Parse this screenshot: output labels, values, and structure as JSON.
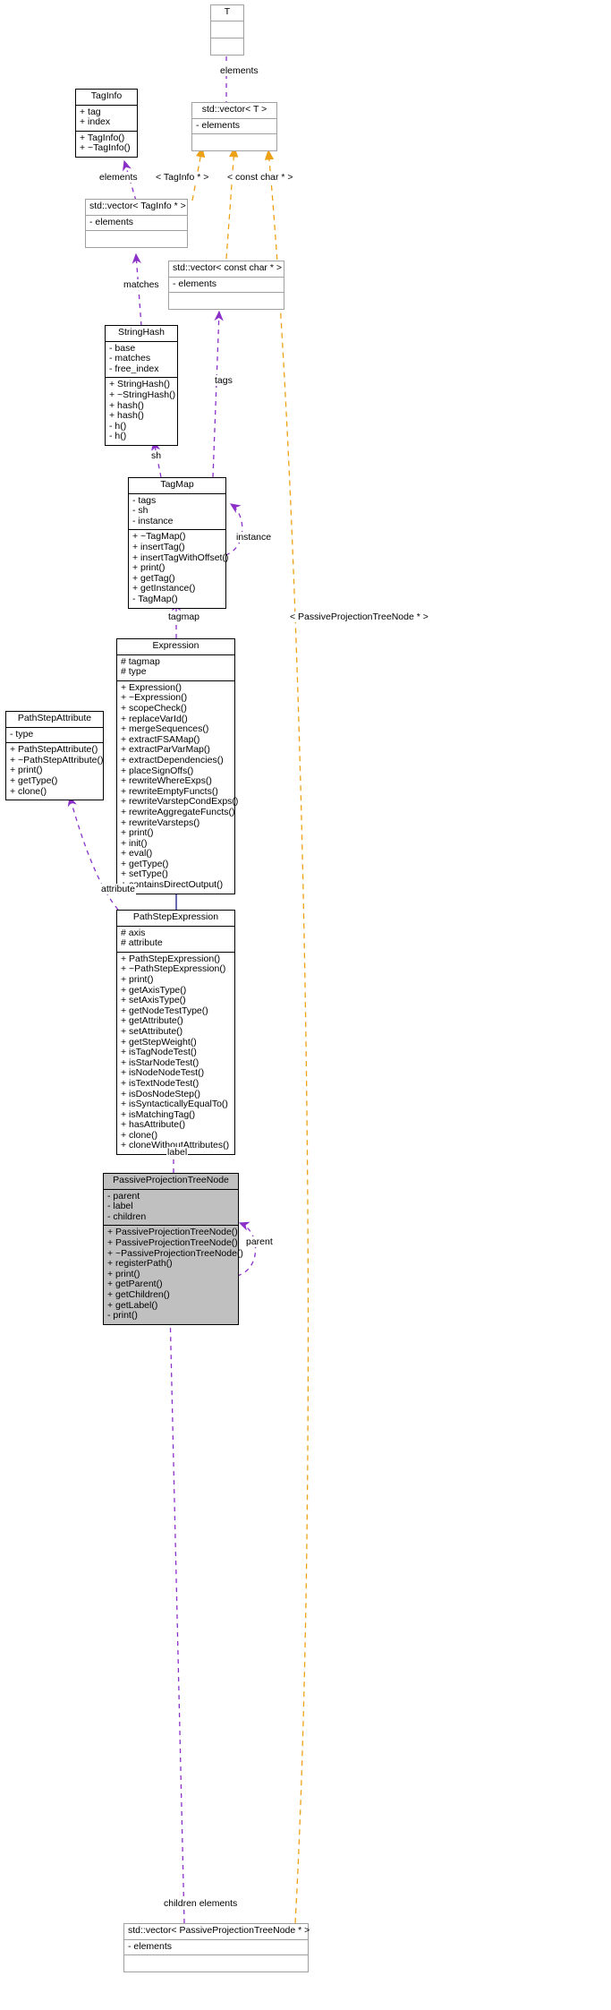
{
  "diagram": {
    "kind": "uml-class-diagram",
    "focus_class": "PassiveProjectionTreeNode",
    "colors": {
      "usage_edge": "#8b2fc9",
      "template_edge": "#eda215",
      "inheritance_edge": "#1a1a8c",
      "box_border": "#000000",
      "template_box_border": "#a0a0a0",
      "focus_fill": "#c0c0c0",
      "background": "#ffffff"
    }
  },
  "classes": {
    "t": {
      "name": "T",
      "attributes": [],
      "operations": []
    },
    "taginfo": {
      "name": "TagInfo",
      "attributes": [
        "+ tag",
        "+ index"
      ],
      "operations": [
        "+ TagInfo()",
        "+ ~TagInfo()"
      ]
    },
    "vector_t": {
      "name": "std::vector< T >",
      "attributes": [
        "- elements"
      ],
      "operations": []
    },
    "vector_taginfo": {
      "name": "std::vector< TagInfo * >",
      "attributes": [
        "- elements"
      ],
      "operations": []
    },
    "vector_constchar": {
      "name": "std::vector< const char * >",
      "attributes": [
        "- elements"
      ],
      "operations": []
    },
    "stringhash": {
      "name": "StringHash",
      "attributes": [
        "- base",
        "- matches",
        "- free_index"
      ],
      "operations": [
        "+ StringHash()",
        "+ ~StringHash()",
        "+ hash()",
        "+ hash()",
        "- h()",
        "- h()"
      ]
    },
    "tagmap": {
      "name": "TagMap",
      "attributes": [
        "- tags",
        "- sh",
        "- instance"
      ],
      "operations": [
        "+ ~TagMap()",
        "+ insertTag()",
        "+ insertTagWithOffset()",
        "+ print()",
        "+ getTag()",
        "+ getInstance()",
        "- TagMap()"
      ]
    },
    "expression": {
      "name": "Expression",
      "attributes": [
        "# tagmap",
        "# type"
      ],
      "operations": [
        "+ Expression()",
        "+ ~Expression()",
        "+ scopeCheck()",
        "+ replaceVarId()",
        "+ mergeSequences()",
        "+ extractFSAMap()",
        "+ extractParVarMap()",
        "+ extractDependencies()",
        "+ placeSignOffs()",
        "+ rewriteWhereExps()",
        "+ rewriteEmptyFuncts()",
        "+ rewriteVarstepCondExps()",
        "+ rewriteAggregateFuncts()",
        "+ rewriteVarsteps()",
        "+ print()",
        "+ init()",
        "+ eval()",
        "+ getType()",
        "+ setType()",
        "+ containsDirectOutput()"
      ]
    },
    "pathstepattribute": {
      "name": "PathStepAttribute",
      "attributes": [
        "- type"
      ],
      "operations": [
        "+ PathStepAttribute()",
        "+ ~PathStepAttribute()",
        "+ print()",
        "+ getType()",
        "+ clone()"
      ]
    },
    "pathstepexpression": {
      "name": "PathStepExpression",
      "attributes": [
        "# axis",
        "# attribute"
      ],
      "operations": [
        "+ PathStepExpression()",
        "+ ~PathStepExpression()",
        "+ print()",
        "+ getAxisType()",
        "+ setAxisType()",
        "+ getNodeTestType()",
        "+ getAttribute()",
        "+ setAttribute()",
        "+ getStepWeight()",
        "+ isTagNodeTest()",
        "+ isStarNodeTest()",
        "+ isNodeNodeTest()",
        "+ isTextNodeTest()",
        "+ isDosNodeStep()",
        "+ isSyntacticallyEqualTo()",
        "+ isMatchingTag()",
        "+ hasAttribute()",
        "+ clone()",
        "+ cloneWithoutAttributes()"
      ]
    },
    "passiveprojectiontreenode": {
      "name": "PassiveProjectionTreeNode",
      "attributes": [
        "- parent",
        "- label",
        "- children"
      ],
      "operations": [
        "+ PassiveProjectionTreeNode()",
        "+ PassiveProjectionTreeNode()",
        "+ ~PassiveProjectionTreeNode()",
        "+ registerPath()",
        "+ print()",
        "+ getParent()",
        "+ getChildren()",
        "+ getLabel()",
        "- print()"
      ]
    },
    "vector_pptn": {
      "name": "std::vector< PassiveProjectionTreeNode * >",
      "attributes": [
        "- elements"
      ],
      "operations": []
    }
  },
  "edge_labels": {
    "elements_t": "elements",
    "elements_taginfo": "elements",
    "tmpl_taginfo": "< TagInfo * >",
    "tmpl_constchar": "< const char * >",
    "matches": "matches",
    "tags": "tags",
    "sh": "sh",
    "instance": "instance",
    "tagmap": "tagmap",
    "tmpl_pptn": "< PassiveProjectionTreeNode * >",
    "attribute": "attribute",
    "label": "label",
    "parent": "parent",
    "children_elements": "children elements"
  }
}
